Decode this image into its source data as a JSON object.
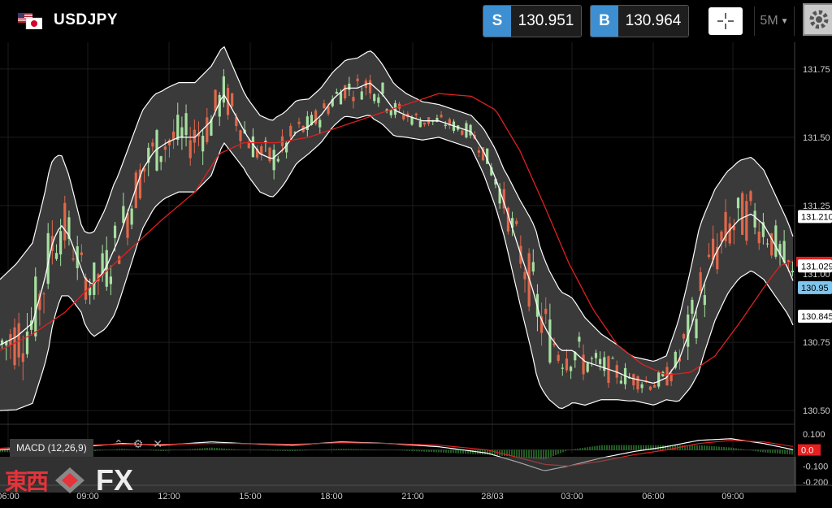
{
  "header": {
    "symbol": "USDJPY",
    "sell": {
      "tag": "S",
      "price": "130.951"
    },
    "buy": {
      "tag": "B",
      "price": "130.964"
    },
    "timeframe": "5M"
  },
  "colors": {
    "background": "#000000",
    "bull_candle": "#a6e0a0",
    "bear_candle": "#e0674a",
    "bollinger": "#ffffff",
    "ma": "#e02020",
    "quote_tag": "#3d8fd1",
    "price_red": "#e52020"
  },
  "price_axis": {
    "ticks": [
      "131.75",
      "131.50",
      "131.25",
      "131.00",
      "130.75",
      "130.50"
    ],
    "tags": [
      {
        "label": "131.210",
        "price": 131.21,
        "style": "white"
      },
      {
        "label": "131.029",
        "price": 131.029,
        "style": "white"
      },
      {
        "label": "130.95",
        "price": 130.95,
        "style": "blue"
      },
      {
        "label": "130.845",
        "price": 130.845,
        "style": "white"
      }
    ]
  },
  "time_axis": {
    "ticks": [
      "06:00",
      "09:00",
      "12:00",
      "15:00",
      "18:00",
      "21:00",
      "28/03",
      "03:00",
      "06:00",
      "09:00"
    ]
  },
  "macd": {
    "label": "MACD (12,26,9)",
    "ticks": [
      "0.100",
      "0.00",
      "-0.100",
      "-0.200"
    ],
    "current": "0.0"
  },
  "watermark": {
    "kanji": "東西",
    "text": "FX"
  },
  "chart_data": {
    "type": "candlestick",
    "ylim": [
      130.45,
      131.8
    ],
    "mid_path": [
      [
        0,
        130.74
      ],
      [
        20,
        130.77
      ],
      [
        40,
        130.82
      ],
      [
        55,
        130.98
      ],
      [
        65,
        131.12
      ],
      [
        75,
        131.18
      ],
      [
        85,
        131.14
      ],
      [
        95,
        131.06
      ],
      [
        105,
        130.98
      ],
      [
        115,
        130.96
      ],
      [
        130,
        131.02
      ],
      [
        145,
        131.12
      ],
      [
        160,
        131.25
      ],
      [
        175,
        131.38
      ],
      [
        190,
        131.45
      ],
      [
        205,
        131.48
      ],
      [
        220,
        131.5
      ],
      [
        240,
        131.5
      ],
      [
        260,
        131.56
      ],
      [
        275,
        131.66
      ],
      [
        290,
        131.58
      ],
      [
        305,
        131.5
      ],
      [
        320,
        131.44
      ],
      [
        335,
        131.42
      ],
      [
        350,
        131.46
      ],
      [
        365,
        131.52
      ],
      [
        380,
        131.54
      ],
      [
        395,
        131.58
      ],
      [
        410,
        131.64
      ],
      [
        425,
        131.68
      ],
      [
        440,
        131.68
      ],
      [
        455,
        131.7
      ],
      [
        470,
        131.66
      ],
      [
        485,
        131.6
      ],
      [
        500,
        131.58
      ],
      [
        520,
        131.56
      ],
      [
        540,
        131.56
      ],
      [
        560,
        131.54
      ],
      [
        580,
        131.52
      ],
      [
        595,
        131.45
      ],
      [
        610,
        131.35
      ],
      [
        625,
        131.22
      ],
      [
        640,
        131.08
      ],
      [
        655,
        130.95
      ],
      [
        665,
        130.84
      ],
      [
        675,
        130.78
      ],
      [
        690,
        130.72
      ],
      [
        705,
        130.72
      ],
      [
        720,
        130.68
      ],
      [
        740,
        130.66
      ],
      [
        760,
        130.64
      ],
      [
        775,
        130.62
      ],
      [
        790,
        130.61
      ],
      [
        805,
        130.6
      ],
      [
        820,
        130.62
      ],
      [
        835,
        130.68
      ],
      [
        850,
        130.8
      ],
      [
        865,
        130.95
      ],
      [
        880,
        131.07
      ],
      [
        895,
        131.15
      ],
      [
        910,
        131.2
      ],
      [
        925,
        131.22
      ],
      [
        940,
        131.18
      ],
      [
        955,
        131.1
      ],
      [
        970,
        131.02
      ],
      [
        978,
        130.96
      ]
    ],
    "ma_path": [
      [
        0,
        130.72
      ],
      [
        40,
        130.78
      ],
      [
        80,
        130.86
      ],
      [
        120,
        130.98
      ],
      [
        160,
        131.09
      ],
      [
        200,
        131.2
      ],
      [
        240,
        131.3
      ],
      [
        270,
        131.44
      ],
      [
        300,
        131.48
      ],
      [
        340,
        131.48
      ],
      [
        380,
        131.5
      ],
      [
        420,
        131.54
      ],
      [
        460,
        131.58
      ],
      [
        500,
        131.62
      ],
      [
        540,
        131.66
      ],
      [
        580,
        131.65
      ],
      [
        610,
        131.6
      ],
      [
        640,
        131.45
      ],
      [
        670,
        131.25
      ],
      [
        700,
        131.04
      ],
      [
        730,
        130.87
      ],
      [
        760,
        130.74
      ],
      [
        790,
        130.67
      ],
      [
        820,
        130.63
      ],
      [
        850,
        130.64
      ],
      [
        880,
        130.7
      ],
      [
        910,
        130.82
      ],
      [
        940,
        130.95
      ],
      [
        960,
        131.03
      ],
      [
        978,
        131.05
      ]
    ],
    "band_width": [
      [
        0,
        0.24
      ],
      [
        60,
        0.32
      ],
      [
        100,
        0.16
      ],
      [
        140,
        0.24
      ],
      [
        200,
        0.2
      ],
      [
        260,
        0.2
      ],
      [
        300,
        0.14
      ],
      [
        340,
        0.14
      ],
      [
        380,
        0.1
      ],
      [
        420,
        0.1
      ],
      [
        460,
        0.12
      ],
      [
        500,
        0.08
      ],
      [
        540,
        0.06
      ],
      [
        580,
        0.06
      ],
      [
        620,
        0.12
      ],
      [
        660,
        0.26
      ],
      [
        700,
        0.2
      ],
      [
        740,
        0.12
      ],
      [
        780,
        0.08
      ],
      [
        820,
        0.08
      ],
      [
        860,
        0.26
      ],
      [
        900,
        0.22
      ],
      [
        940,
        0.2
      ],
      [
        978,
        0.16
      ]
    ],
    "candle_count": 190,
    "macd_range": [
      -0.22,
      0.16
    ],
    "macd_path": [
      [
        0,
        0.0
      ],
      [
        60,
        0.03
      ],
      [
        100,
        0.02
      ],
      [
        150,
        0.04
      ],
      [
        200,
        0.03
      ],
      [
        260,
        0.05
      ],
      [
        300,
        0.04
      ],
      [
        360,
        0.03
      ],
      [
        420,
        0.05
      ],
      [
        480,
        0.04
      ],
      [
        540,
        0.02
      ],
      [
        600,
        -0.02
      ],
      [
        640,
        -0.08
      ],
      [
        670,
        -0.13
      ],
      [
        700,
        -0.1
      ],
      [
        740,
        -0.05
      ],
      [
        780,
        -0.01
      ],
      [
        820,
        0.02
      ],
      [
        860,
        0.06
      ],
      [
        900,
        0.07
      ],
      [
        940,
        0.04
      ],
      [
        978,
        0.0
      ]
    ],
    "signal_path": [
      [
        0,
        0.01
      ],
      [
        60,
        0.03
      ],
      [
        100,
        0.03
      ],
      [
        150,
        0.035
      ],
      [
        200,
        0.035
      ],
      [
        260,
        0.04
      ],
      [
        300,
        0.04
      ],
      [
        360,
        0.035
      ],
      [
        420,
        0.045
      ],
      [
        480,
        0.04
      ],
      [
        540,
        0.03
      ],
      [
        600,
        0.0
      ],
      [
        640,
        -0.05
      ],
      [
        670,
        -0.09
      ],
      [
        700,
        -0.1
      ],
      [
        740,
        -0.07
      ],
      [
        780,
        -0.03
      ],
      [
        820,
        0.0
      ],
      [
        860,
        0.04
      ],
      [
        900,
        0.06
      ],
      [
        940,
        0.05
      ],
      [
        978,
        0.02
      ]
    ]
  }
}
